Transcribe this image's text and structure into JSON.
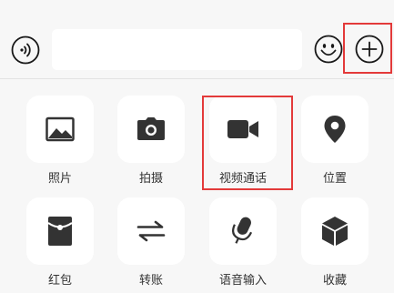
{
  "input_bar": {
    "voice_icon": "voice-input-icon",
    "input_value": "",
    "input_placeholder": "",
    "emoji_icon": "emoji-icon",
    "plus_icon": "plus-icon"
  },
  "highlight_color": "#e33a3a",
  "panel": {
    "items": [
      {
        "label": "照片",
        "icon": "image-icon"
      },
      {
        "label": "拍摄",
        "icon": "camera-icon"
      },
      {
        "label": "视频通话",
        "icon": "video-camera-icon"
      },
      {
        "label": "位置",
        "icon": "location-pin-icon"
      },
      {
        "label": "红包",
        "icon": "red-packet-icon"
      },
      {
        "label": "转账",
        "icon": "transfer-arrows-icon"
      },
      {
        "label": "语音输入",
        "icon": "microphone-icon"
      },
      {
        "label": "收藏",
        "icon": "cube-icon"
      }
    ]
  }
}
